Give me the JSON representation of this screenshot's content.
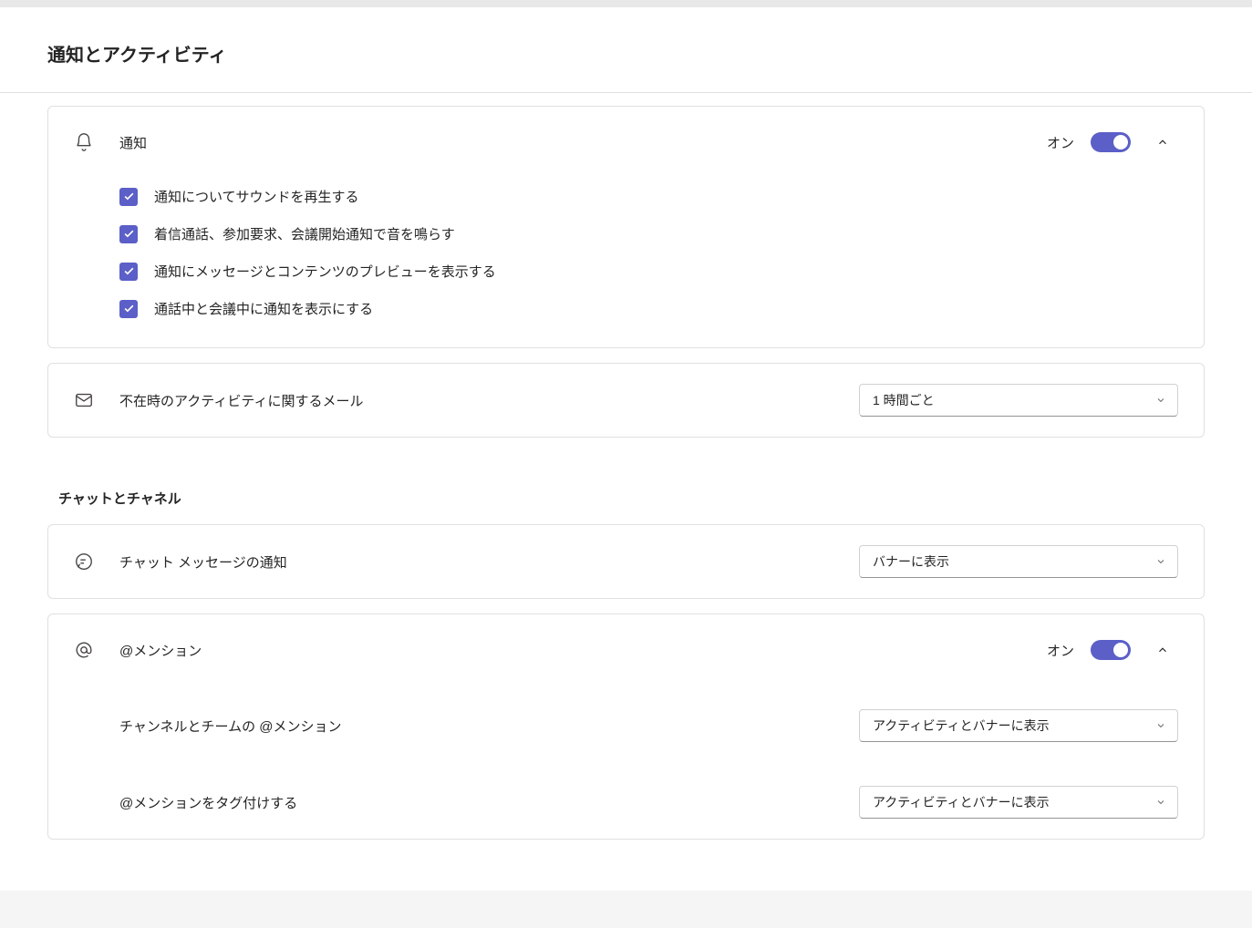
{
  "page": {
    "title": "通知とアクティビティ"
  },
  "notifications": {
    "label": "通知",
    "toggle_state": "オン",
    "checkboxes": [
      {
        "label": "通知についてサウンドを再生する"
      },
      {
        "label": "着信通話、参加要求、会議開始通知で音を鳴らす"
      },
      {
        "label": "通知にメッセージとコンテンツのプレビューを表示する"
      },
      {
        "label": "通話中と会議中に通知を表示にする"
      }
    ]
  },
  "missed_activity": {
    "label": "不在時のアクティビティに関するメール",
    "select_value": "1 時間ごと"
  },
  "chat_section": {
    "heading": "チャットとチャネル"
  },
  "chat_notify": {
    "label": "チャット メッセージの通知",
    "select_value": "バナーに表示"
  },
  "mentions": {
    "label": "@メンション",
    "toggle_state": "オン",
    "rows": [
      {
        "label": "チャンネルとチームの @メンション",
        "select_value": "アクティビティとバナーに表示"
      },
      {
        "label": "@メンションをタグ付けする",
        "select_value": "アクティビティとバナーに表示"
      }
    ]
  }
}
